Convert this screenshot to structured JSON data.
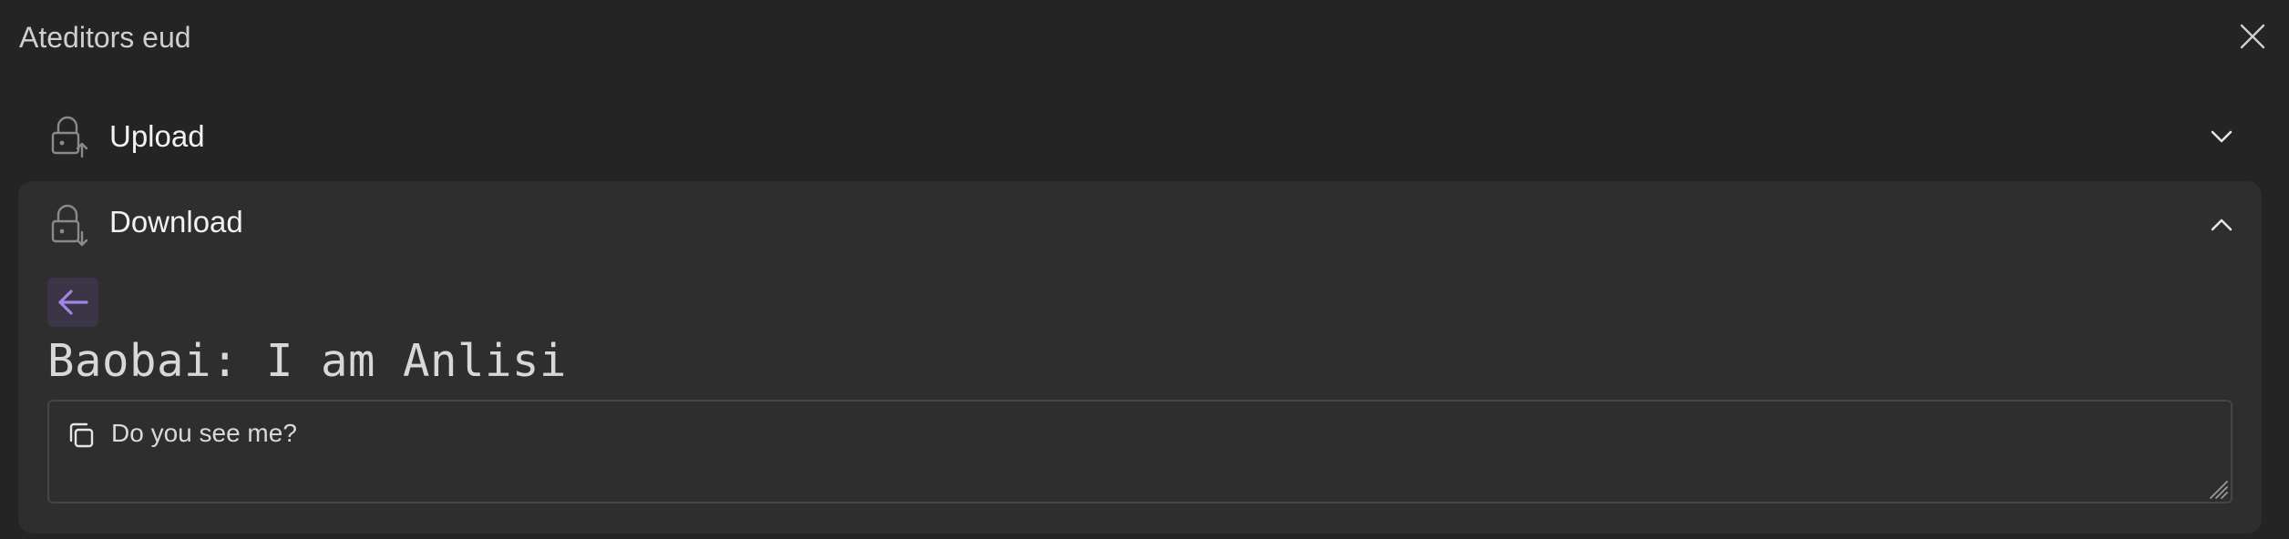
{
  "window": {
    "title": "Ateditors eud"
  },
  "sections": {
    "upload": {
      "label": "Upload",
      "icon": "lock-upload-icon",
      "expanded": false
    },
    "download": {
      "label": "Download",
      "icon": "lock-download-icon",
      "expanded": true,
      "message_title": "Baobai: I am Anlisi",
      "message_text": "Do you see me?"
    }
  },
  "colors": {
    "background": "#242424",
    "panel": "#2e2e2e",
    "accent": "#9f86e6",
    "back_button_bg": "#3b3547"
  }
}
